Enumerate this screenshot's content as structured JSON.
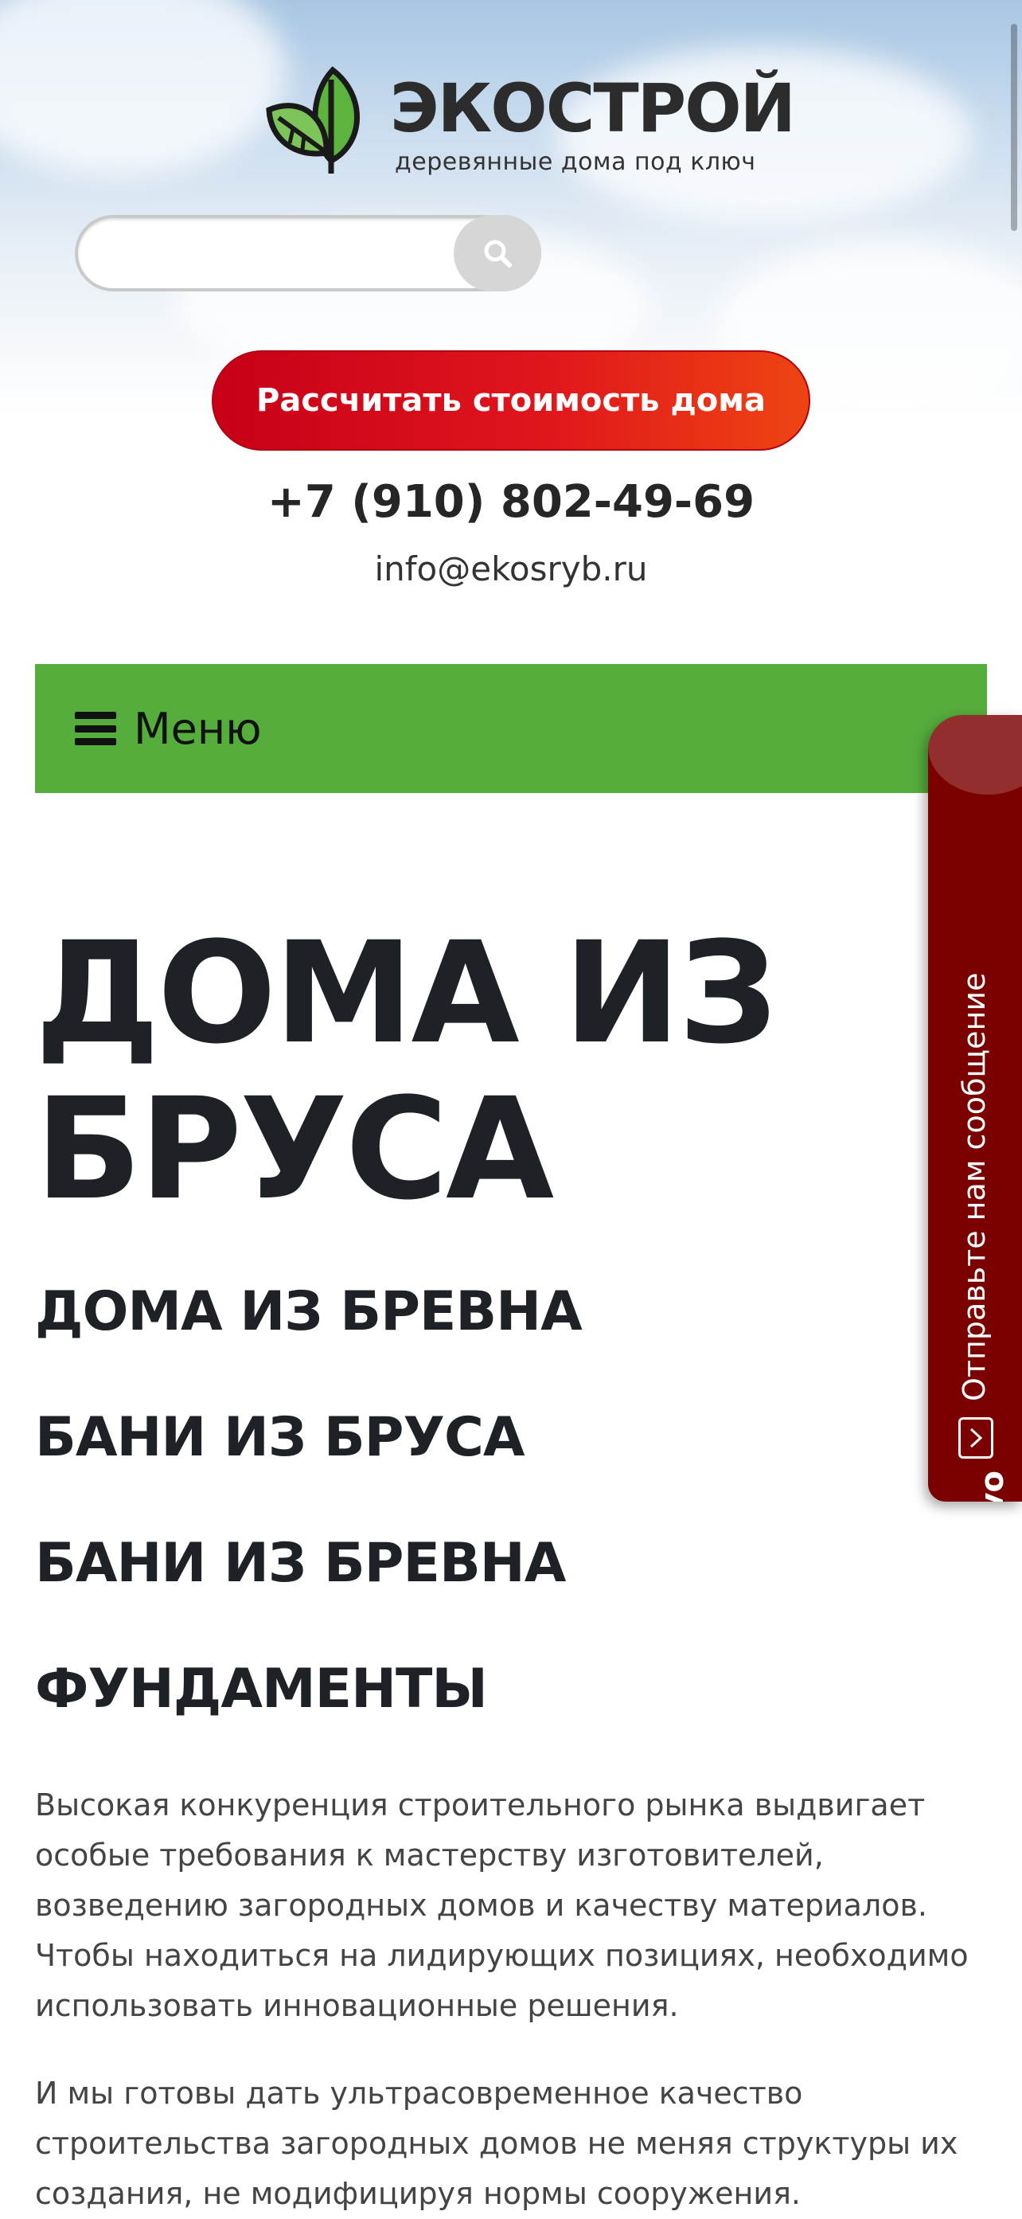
{
  "logo": {
    "title": "ЭКОСТРОЙ",
    "subtitle": "деревянные дома под ключ"
  },
  "search": {
    "placeholder": ""
  },
  "cta": {
    "label": "Рассчитать стоимость дома"
  },
  "contacts": {
    "phone": "+7 (910) 802-49-69",
    "email": "info@ekosryb.ru"
  },
  "nav": {
    "menu_label": "Меню"
  },
  "main": {
    "title": "ДОМА ИЗ БРУСА",
    "links": [
      "ДОМА ИЗ БРЕВНА",
      "БАНИ ИЗ БРУСА",
      "БАНИ ИЗ БРЕВНА",
      "ФУНДАМЕНТЫ"
    ],
    "paragraphs": [
      "Высокая конкуренция строительного рынка выдвигает особые требования к мастерству изготовителей, возведению загородных домов и качеству материалов. Чтобы находиться на лидирующих позициях, необходимо использовать инновационные решения.",
      "И мы готовы дать ультрасовременное качество строительства загородных домов не меняя структуры их создания, не модифицируя нормы сооружения."
    ]
  },
  "chat_widget": {
    "brand": "jivo",
    "label": "Отправьте нам сообщение",
    "icon": "chevron-right-icon"
  },
  "colors": {
    "accent_green": "#55ad3c",
    "cta_red": "#e0151c",
    "chat_red": "#7b0000"
  }
}
